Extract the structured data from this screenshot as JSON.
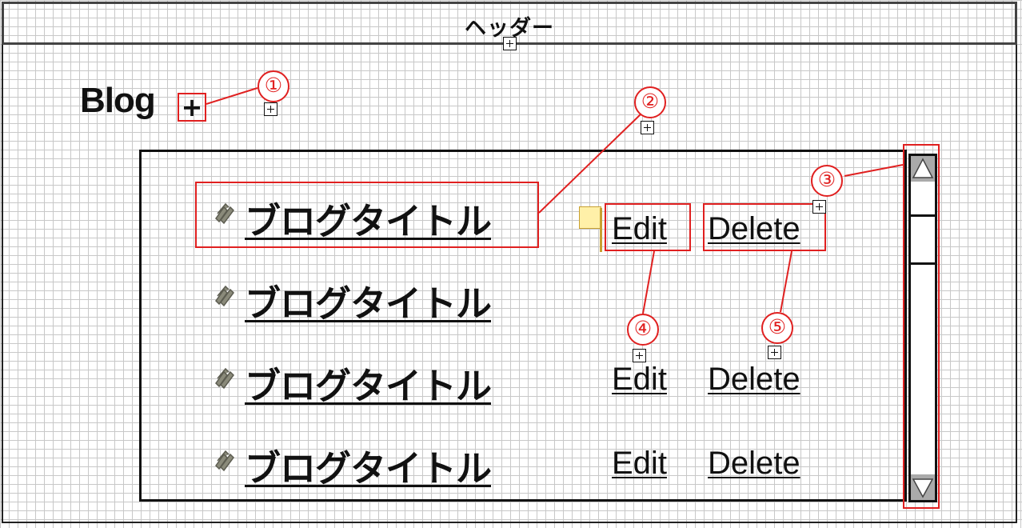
{
  "header": {
    "title": "ヘッダー"
  },
  "page": {
    "title": "Blog",
    "add_label": "+"
  },
  "blog_list": {
    "rows": [
      {
        "title": "ブログタイトル",
        "edit": "Edit",
        "delete": "Delete"
      },
      {
        "title": "ブログタイトル",
        "edit": "",
        "delete": ""
      },
      {
        "title": "ブログタイトル",
        "edit": "Edit",
        "delete": "Delete"
      },
      {
        "title": "ブログタイトル",
        "edit": "Edit",
        "delete": "Delete"
      }
    ]
  },
  "annotations": {
    "badges": [
      "①",
      "②",
      "③",
      "④",
      "⑤"
    ],
    "accent_color": "#e02020"
  },
  "icons": {
    "expander": "plus-square-icon",
    "row_bullet": "pencil-scribble-icon",
    "scroll_up": "triangle-up-icon",
    "scroll_down": "triangle-down-icon"
  }
}
